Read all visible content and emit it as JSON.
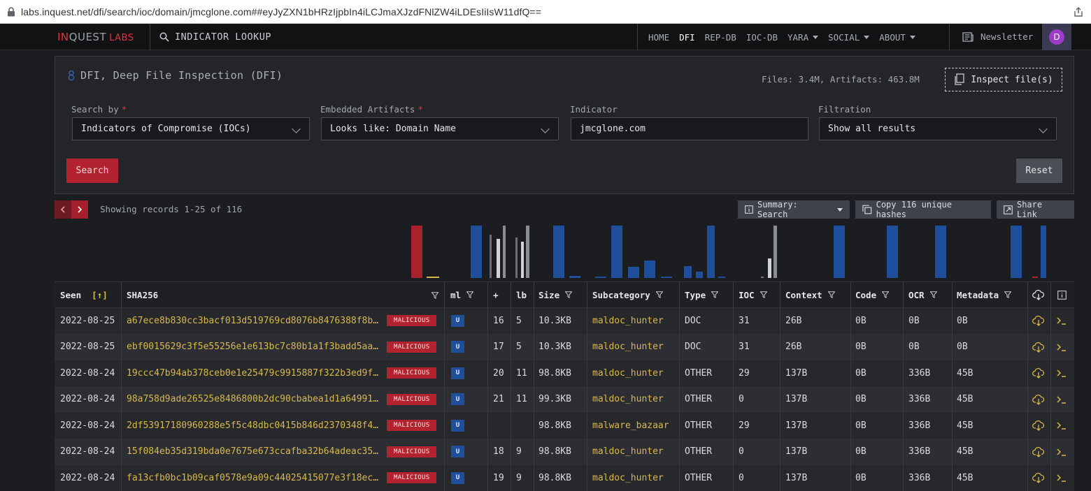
{
  "browser": {
    "url": "labs.inquest.net/dfi/search/ioc/domain/jmcglone.com##eyJyZXN1bHRzIjpbIn4iLCJmaXJzdFNlZW4iLDEsIiIsW11dfQ=="
  },
  "nav": {
    "logo_in": "IN",
    "logo_quest": "QUEST",
    "logo_labs": "LABS",
    "lookup": "INDICATOR LOOKUP",
    "links": [
      {
        "label": "HOME"
      },
      {
        "label": "DFI"
      },
      {
        "label": "REP-DB"
      },
      {
        "label": "IOC-DB"
      },
      {
        "label": "YARA"
      },
      {
        "label": "SOCIAL"
      },
      {
        "label": "ABOUT"
      }
    ],
    "newsletter": "Newsletter",
    "avatar": "D"
  },
  "panel": {
    "title": "DFI, Deep File Inspection (DFI)",
    "stats": "Files: 3.4M, Artifacts: 463.8M",
    "inspect": "Inspect file(s)",
    "search_by_label": "Search by",
    "search_by_value": "Indicators of Compromise (IOCs)",
    "artifacts_label": "Embedded Artifacts",
    "artifacts_value": "Looks like: Domain Name",
    "indicator_label": "Indicator",
    "indicator_value": "jmcglone.com",
    "filtration_label": "Filtration",
    "filtration_value": "Show all results",
    "required_mark": "*",
    "search_btn": "Search",
    "reset_btn": "Reset"
  },
  "toolbar": {
    "records": "Showing records 1-25 of 116",
    "summary": "Summary: Search",
    "copy": "Copy 116 unique hashes",
    "share": "Share Link"
  },
  "colors": {
    "accent_red": "#b3222f",
    "bar_blue": "#1f4f9a",
    "hash_yellow": "#d9b84a"
  },
  "table": {
    "headers": {
      "seen": "Seen",
      "sort": "[↑]",
      "sha": "SHA256",
      "ml": "ml",
      "plus": "+",
      "lb": "lb",
      "size": "Size",
      "subcategory": "Subcategory",
      "type": "Type",
      "ioc": "IOC",
      "context": "Context",
      "code": "Code",
      "ocr": "OCR",
      "metadata": "Metadata"
    },
    "rows": [
      {
        "seen": "2022-08-25",
        "sha": "a67ece8b830cc3bacf013d519769cd8076b8476388f8b…",
        "verdict": "MALICIOUS",
        "ml": "U",
        "plus": "16",
        "lb": "5",
        "size": "10.3KB",
        "subcategory": "maldoc_hunter",
        "type": "DOC",
        "ioc": "31",
        "context": "26B",
        "code": "0B",
        "ocr": "0B",
        "metadata": "0B"
      },
      {
        "seen": "2022-08-25",
        "sha": "ebf0015629c3f5e55256e1e613bc7c80b1a1f3badd5aa…",
        "verdict": "MALICIOUS",
        "ml": "U",
        "plus": "17",
        "lb": "5",
        "size": "10.3KB",
        "subcategory": "maldoc_hunter",
        "type": "DOC",
        "ioc": "31",
        "context": "26B",
        "code": "0B",
        "ocr": "0B",
        "metadata": "0B"
      },
      {
        "seen": "2022-08-24",
        "sha": "19ccc47b94ab378ceb0e1e25479c9915887f322b3ed9f…",
        "verdict": "MALICIOUS",
        "ml": "U",
        "plus": "20",
        "lb": "11",
        "size": "98.8KB",
        "subcategory": "maldoc_hunter",
        "type": "OTHER",
        "ioc": "29",
        "context": "137B",
        "code": "0B",
        "ocr": "336B",
        "metadata": "45B"
      },
      {
        "seen": "2022-08-24",
        "sha": "98a758d9ade26525e8486800b2dc90cbabea1d1a64991…",
        "verdict": "MALICIOUS",
        "ml": "U",
        "plus": "21",
        "lb": "11",
        "size": "99.3KB",
        "subcategory": "maldoc_hunter",
        "type": "OTHER",
        "ioc": "0",
        "context": "137B",
        "code": "0B",
        "ocr": "336B",
        "metadata": "45B"
      },
      {
        "seen": "2022-08-24",
        "sha": "2df53917180960288e5f5c48dbc0415b846d2370348f4…",
        "verdict": "MALICIOUS",
        "ml": "U",
        "plus": "",
        "lb": "",
        "size": "98.8KB",
        "subcategory": "malware_bazaar",
        "type": "OTHER",
        "ioc": "29",
        "context": "137B",
        "code": "0B",
        "ocr": "336B",
        "metadata": "45B"
      },
      {
        "seen": "2022-08-24",
        "sha": "15f084eb35d319bda0e7675e673ccafba32b64adeac35…",
        "verdict": "MALICIOUS",
        "ml": "U",
        "plus": "18",
        "lb": "9",
        "size": "98.8KB",
        "subcategory": "maldoc_hunter",
        "type": "OTHER",
        "ioc": "0",
        "context": "137B",
        "code": "0B",
        "ocr": "336B",
        "metadata": "45B"
      },
      {
        "seen": "2022-08-24",
        "sha": "fa13cfb0bc1b09caf0578e9a09c44025415077e3f18ec…",
        "verdict": "MALICIOUS",
        "ml": "U",
        "plus": "19",
        "lb": "9",
        "size": "98.8KB",
        "subcategory": "maldoc_hunter",
        "type": "OTHER",
        "ioc": "0",
        "context": "137B",
        "code": "0B",
        "ocr": "336B",
        "metadata": "45B"
      }
    ]
  }
}
